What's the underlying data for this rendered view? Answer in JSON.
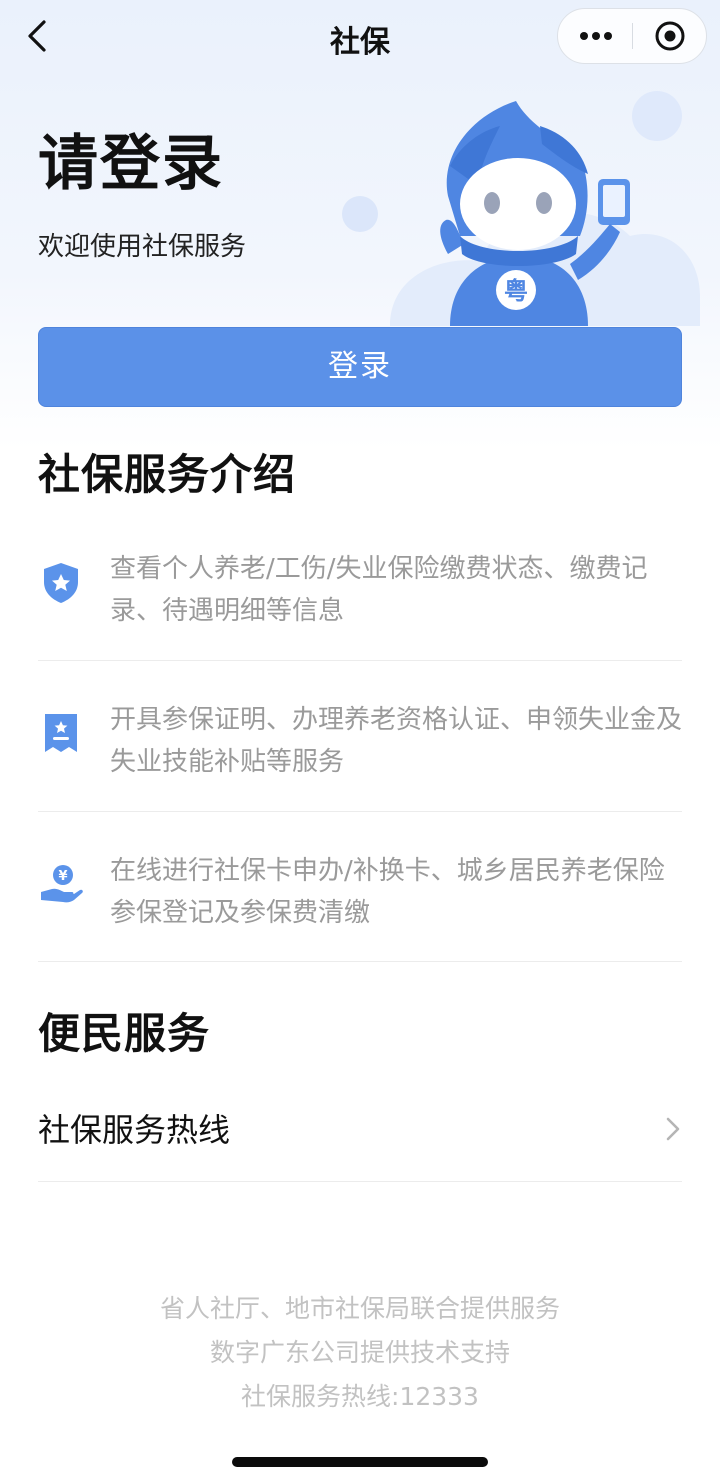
{
  "nav": {
    "title": "社保",
    "back_icon": "chevron-left-icon",
    "more_icon": "more-dots-icon",
    "close_icon": "target-close-icon"
  },
  "hero": {
    "title": "请登录",
    "subtitle": "欢迎使用社保服务",
    "mascot_badge": "粤"
  },
  "login_button": {
    "label": "登录"
  },
  "intro": {
    "title": "社保服务介绍",
    "items": [
      {
        "icon": "shield-star-icon",
        "text": "查看个人养老/工伤/失业保险缴费状态、缴费记录、待遇明细等信息"
      },
      {
        "icon": "certificate-icon",
        "text": "开具参保证明、办理养老资格认证、申领失业金及失业技能补贴等服务"
      },
      {
        "icon": "hand-coin-icon",
        "text": "在线进行社保卡申办/补换卡、城乡居民养老保险参保登记及参保费清缴"
      }
    ]
  },
  "convenience": {
    "title": "便民服务",
    "items": [
      {
        "label": "社保服务热线",
        "icon": "chevron-right-icon"
      }
    ]
  },
  "footer": {
    "line1": "省人社厅、地市社保局联合提供服务",
    "line2": "数字广东公司提供技术支持",
    "line3": "社保服务热线:12333"
  },
  "colors": {
    "accent": "#5b91e8",
    "icon_blue": "#5b93ea",
    "text_muted": "#9a9a9a",
    "footer_text": "#c2c2c2"
  }
}
